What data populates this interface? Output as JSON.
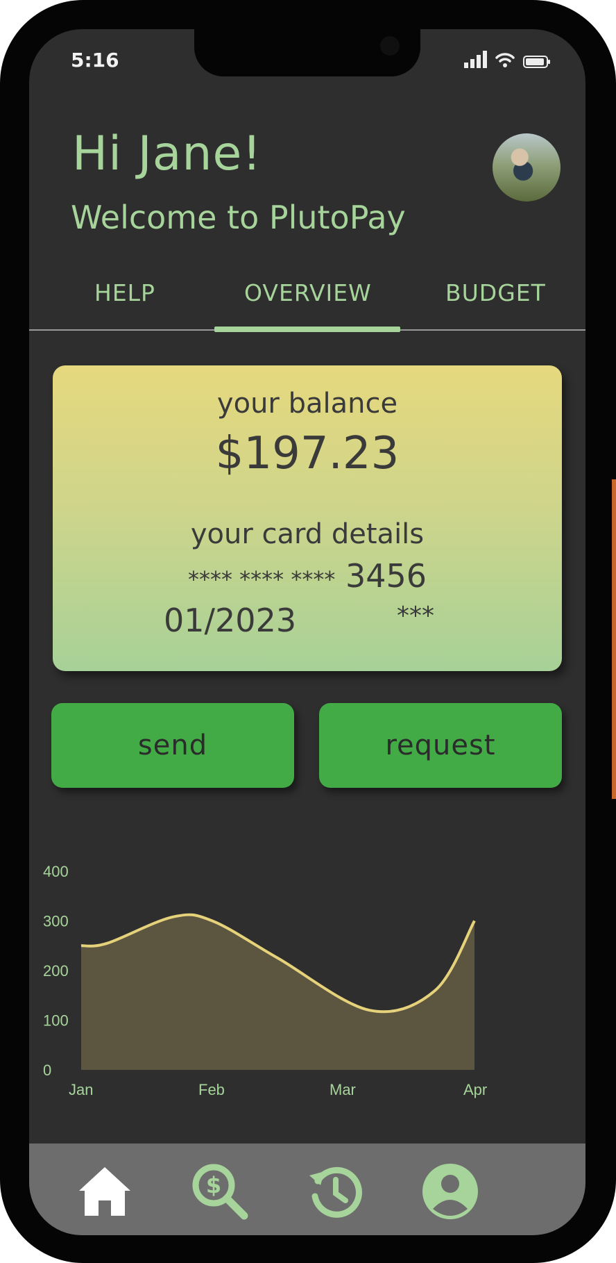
{
  "status": {
    "time": "5:16"
  },
  "header": {
    "greeting": "Hi Jane!",
    "welcome": "Welcome to PlutoPay"
  },
  "tabs": [
    {
      "label": "HELP",
      "active": false
    },
    {
      "label": "OVERVIEW",
      "active": true
    },
    {
      "label": "BUDGET",
      "active": false
    }
  ],
  "card": {
    "balance_label": "your balance",
    "balance": "$197.23",
    "details_label": "your card details",
    "number_masked": "**** **** ****",
    "number_last4": "3456",
    "expiry": "01/2023",
    "cvv": "***"
  },
  "actions": {
    "send_label": "send",
    "request_label": "request"
  },
  "chart_data": {
    "type": "area",
    "categories": [
      "Jan",
      "Feb",
      "Mar",
      "Apr"
    ],
    "x": [
      0,
      1,
      2,
      3
    ],
    "series": [
      {
        "x": [
          0,
          0.2,
          0.7,
          1.0,
          1.5,
          2.2,
          2.7,
          3.0
        ],
        "values": [
          250,
          255,
          308,
          300,
          225,
          120,
          160,
          300
        ]
      }
    ],
    "yticks": [
      0,
      100,
      200,
      300,
      400
    ],
    "ylim": [
      0,
      400
    ],
    "xlim": [
      0,
      3
    ],
    "colors": {
      "line": "#e6d27a",
      "fill": "#5c5640",
      "tick": "#a6d49a"
    }
  },
  "nav": {
    "items": [
      "home-icon",
      "search-money-icon",
      "history-icon",
      "profile-icon"
    ],
    "colors": {
      "home": "#ffffff",
      "others": "#a6d49a",
      "background": "#6d6d6d"
    }
  },
  "colors": {
    "accent": "#a6d49a",
    "screen_bg": "#2e2e2e",
    "button": "#42ab46"
  }
}
